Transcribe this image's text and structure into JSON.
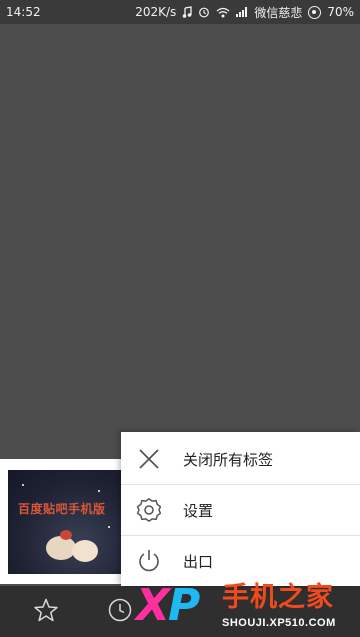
{
  "status_bar": {
    "time": "14:52",
    "network_speed": "202K/s",
    "carrier": "微信慈悲",
    "battery": "70%"
  },
  "tab_preview": {
    "thumbnail_title": "百度贴吧手机版"
  },
  "overflow_menu": {
    "items": [
      {
        "label": "关闭所有标签",
        "icon": "close-icon"
      },
      {
        "label": "设置",
        "icon": "gear-icon"
      },
      {
        "label": "出口",
        "icon": "power-icon"
      }
    ]
  },
  "bottom_nav": {
    "items": [
      {
        "icon": "star-icon"
      },
      {
        "icon": "clock-icon"
      }
    ]
  },
  "watermark": {
    "logo_x": "X",
    "logo_p": "P",
    "brand": "手机之家",
    "url": "SHOUJI.XP510.COM"
  },
  "colors": {
    "background": "#4d4d4d",
    "menu_background": "#ffffff",
    "bottom_bar": "#2f2f2f",
    "watermark_pink": "#ff2fa0",
    "watermark_blue": "#1fb8f0",
    "watermark_orange": "#f24a1c"
  }
}
